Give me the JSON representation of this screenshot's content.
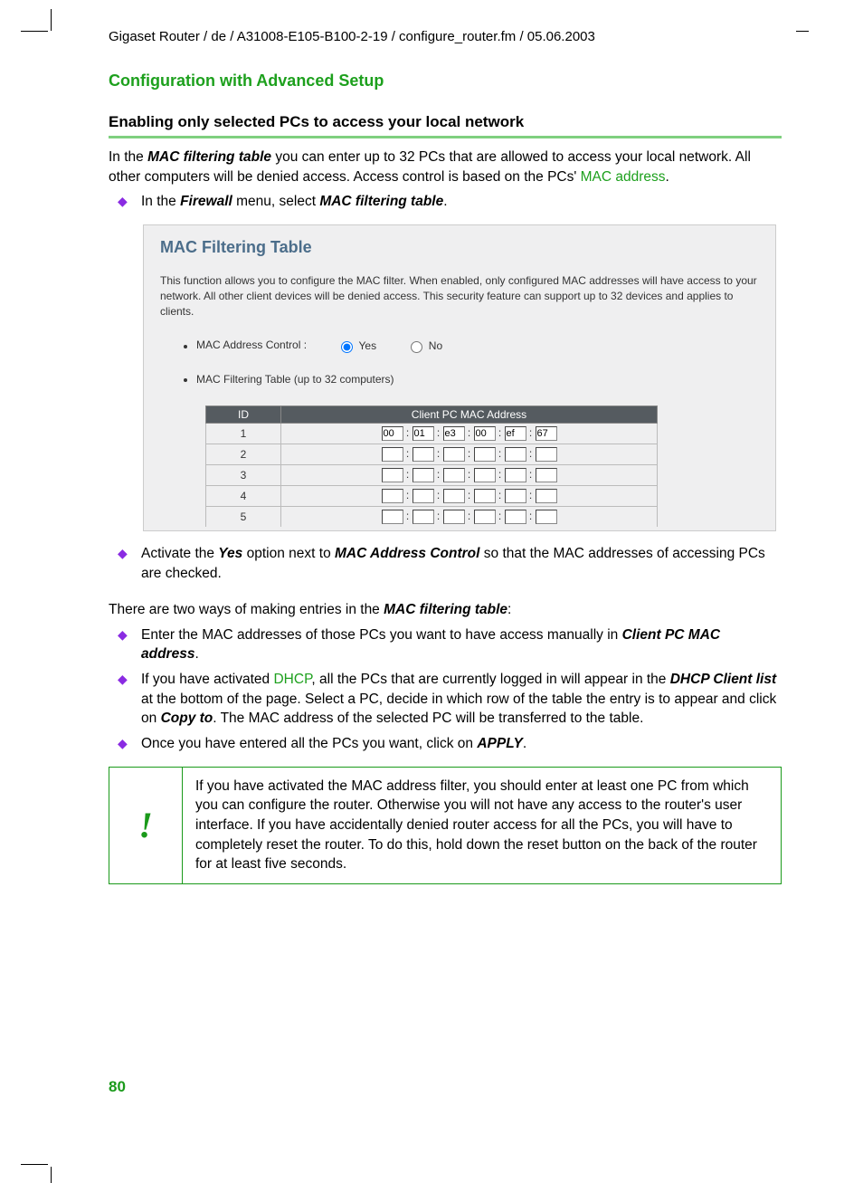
{
  "header_path": "Gigaset Router / de / A31008-E105-B100-2-19 / configure_router.fm / 05.06.2003",
  "section_title": "Configuration with Advanced Setup",
  "subsection_title": "Enabling only selected PCs to access your local network",
  "intro": {
    "prefix": "In the ",
    "mft": "MAC filtering table",
    "mid": " you can enter up to 32 PCs that are allowed to access your local network. All other computers will be denied access. Access control is based on the PCs' ",
    "mac_addr": "MAC address",
    "suffix": "."
  },
  "bullet1": {
    "prefix": "In the ",
    "fw": "Firewall",
    "mid": " menu, select ",
    "mft": "MAC filtering table",
    "suffix": "."
  },
  "shot": {
    "title": "MAC Filtering Table",
    "desc": "This function allows you to configure the MAC filter. When enabled, only configured MAC addresses will have access to your network. All other client devices will be denied access. This security feature can support up to 32 devices and applies to clients.",
    "control_label": "MAC Address Control :",
    "yes": "Yes",
    "no": "No",
    "table_label": "MAC Filtering Table (up to 32 computers)",
    "th_id": "ID",
    "th_mac": "Client PC MAC Address",
    "rows": [
      {
        "id": "1",
        "mac": [
          "00",
          "01",
          "e3",
          "00",
          "ef",
          "67"
        ]
      },
      {
        "id": "2",
        "mac": [
          "",
          "",
          "",
          "",
          "",
          ""
        ]
      },
      {
        "id": "3",
        "mac": [
          "",
          "",
          "",
          "",
          "",
          ""
        ]
      },
      {
        "id": "4",
        "mac": [
          "",
          "",
          "",
          "",
          "",
          ""
        ]
      },
      {
        "id": "5",
        "mac": [
          "",
          "",
          "",
          "",
          "",
          ""
        ]
      }
    ]
  },
  "bullet2": {
    "prefix": "Activate the ",
    "yes": "Yes",
    "mid": " option next to ",
    "mac_ctrl": "MAC Address Control",
    "suffix": " so that the MAC addresses of accessing PCs are checked."
  },
  "twoway": {
    "prefix": "There are two ways of making entries in the ",
    "mft": "MAC filtering table",
    "suffix": ":"
  },
  "bullet3": {
    "prefix": "Enter the MAC addresses of those PCs you want to have access manually in ",
    "client": "Client PC  MAC address",
    "suffix": "."
  },
  "bullet4": {
    "prefix": "If you have activated ",
    "dhcp": "DHCP",
    "mid1": ", all the PCs that are currently logged in will appear in the ",
    "dcl": "DHCP Client list",
    "mid2": " at the bottom of the page. Select a PC, decide in which row of the table the entry is to appear and click on ",
    "copy": "Copy to",
    "suffix": ". The MAC address of the selected PC will be transferred to the table."
  },
  "bullet5": {
    "prefix": "Once you have entered all the PCs you want, click on ",
    "apply": "APPLY",
    "suffix": "."
  },
  "warn": {
    "icon": "!",
    "text": "If you have activated the MAC address filter, you should enter at least one PC from which you can configure the router. Otherwise you will not have any access to the router's user interface. If you have accidentally denied router access for all the PCs, you will have to completely reset the router. To do this, hold down the reset button on the back of the router for at least five seconds."
  },
  "page_number": "80"
}
